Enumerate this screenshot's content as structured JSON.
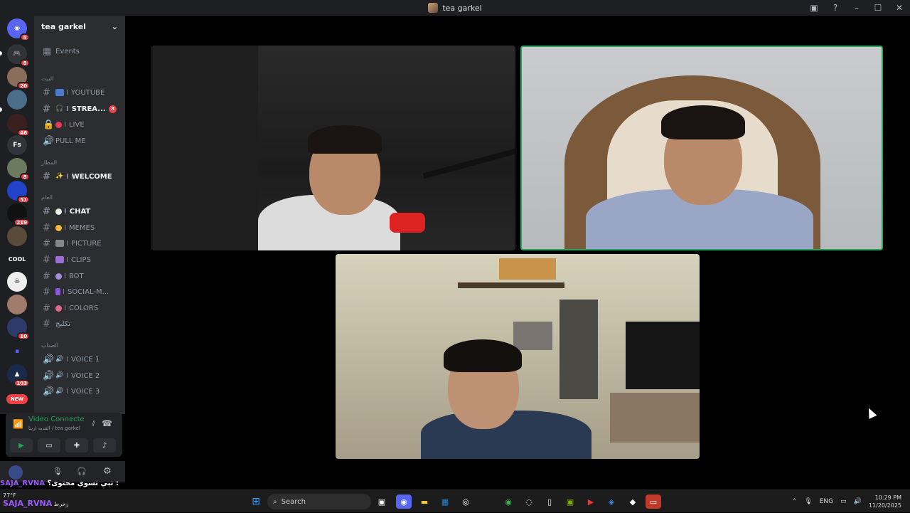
{
  "window": {
    "title": "tea garkel"
  },
  "server": {
    "name": "tea garkel",
    "events_label": "Events"
  },
  "guilds": [
    {
      "badge": "5"
    },
    {
      "badge": "8"
    },
    {
      "badge": "20"
    },
    {
      "badge": ""
    },
    {
      "badge": "46"
    },
    {
      "label": "Fs",
      "badge": ""
    },
    {
      "badge": "8"
    },
    {
      "badge": "51"
    },
    {
      "badge": "219"
    },
    {
      "badge": ""
    },
    {
      "label": "COOL",
      "badge": ""
    },
    {
      "badge": ""
    },
    {
      "badge": ""
    },
    {
      "badge": "10"
    },
    {
      "badge": ""
    },
    {
      "badge": "103"
    },
    {
      "label": "NEW",
      "badge": ""
    }
  ],
  "categories": {
    "cat1": "البيت",
    "cat2": "المطار",
    "cat3": "العام",
    "cat4": "الصناب"
  },
  "channels": {
    "youtube": "YOUTUBE",
    "streams": "STREA...",
    "streams_badge": "8",
    "live": "LIVE",
    "pull_me": "PULL ME",
    "welcome": "WELCOME",
    "chat": "CHAT",
    "memes": "MEMES",
    "picture": "PICTURE",
    "clips": "CLIPS",
    "bot": "BOT",
    "social": "SOCIAL-M...",
    "colors": "COLORS",
    "arabic": "تكليج",
    "voice1": "VOICE 1",
    "voice2": "VOICE 2",
    "voice3": "VOICE 3"
  },
  "voice_panel": {
    "status": "Video Connecte",
    "sub": "القديه ارينا / tea garkel"
  },
  "overlay": {
    "line1_text": "تبي تسوي محتوى؟ :",
    "line1_name": "SAJA_RVNA",
    "line2_name": "SAJA_RVNA",
    "line2_text": "زخرط"
  },
  "taskbar": {
    "weather_temp": "77°F",
    "search_placeholder": "Search",
    "lang": "ENG",
    "time": "10:29 PM",
    "date": "11/20/2025"
  },
  "colors": {
    "accent_green": "#23a55a",
    "badge_red": "#f23f43",
    "bg_dark": "#1e1f22",
    "sidebar": "#2b2d31"
  }
}
